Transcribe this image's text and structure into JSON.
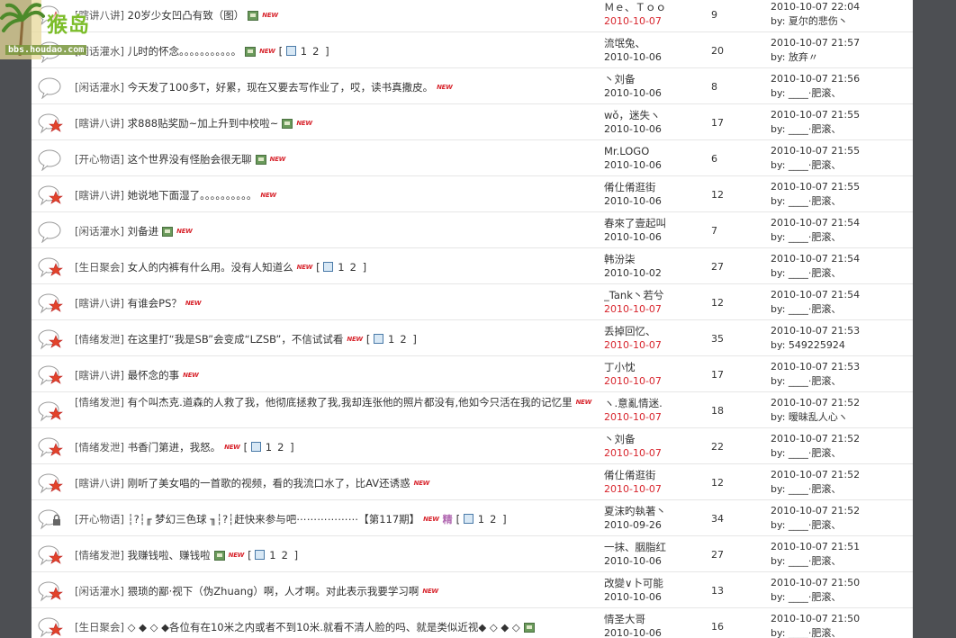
{
  "logo": {
    "text": "猴岛",
    "url": "bbs.houdao.com"
  },
  "threads": [
    {
      "icon": "hot",
      "forum": "[瞎讲八讲]",
      "subject": "20岁少女凹凸有致（图）",
      "image": true,
      "new": true,
      "digest": false,
      "pages": [],
      "author": "Ｍｅ、Ｔｏｏ",
      "date": "2010-10-07",
      "today": true,
      "replies": "9",
      "last_time": "2010-10-07 22:04",
      "last_by": "by: 夏尔的悲伤丶"
    },
    {
      "icon": "normal",
      "forum": "[闲话灌水]",
      "subject": "儿时的怀念。。。。。。。。。。。",
      "image": true,
      "new": true,
      "digest": false,
      "pages": [
        "1",
        "2"
      ],
      "author": "流氓兔、",
      "date": "2010-10-06",
      "today": false,
      "replies": "20",
      "last_time": "2010-10-07 21:57",
      "last_by": "by:          放弃〃"
    },
    {
      "icon": "normal",
      "forum": "[闲话灌水]",
      "subject": "今天发了100多T，好累，现在又要去写作业了，哎，读书真撒皮。",
      "image": false,
      "new": true,
      "digest": false,
      "pages": [],
      "author": "丶刘备",
      "date": "2010-10-06",
      "today": false,
      "replies": "8",
      "last_time": "2010-10-07 21:56",
      "last_by": "by: ____·肥滚、"
    },
    {
      "icon": "hot",
      "forum": "[瞎讲八讲]",
      "subject": "求888贴奖励~加上升到中校啦~",
      "image": true,
      "new": true,
      "digest": false,
      "pages": [],
      "author": "wǒ，迷失ヽ",
      "date": "2010-10-06",
      "today": false,
      "replies": "17",
      "last_time": "2010-10-07 21:55",
      "last_by": "by: ____·肥滚、"
    },
    {
      "icon": "normal",
      "forum": "[开心物语]",
      "subject": "这个世界没有怪胎会很无聊",
      "image": true,
      "new": true,
      "digest": false,
      "pages": [],
      "author": "Mr.LOGO",
      "date": "2010-10-06",
      "today": false,
      "replies": "6",
      "last_time": "2010-10-07 21:55",
      "last_by": "by: ____·肥滚、"
    },
    {
      "icon": "hot",
      "forum": "[瞎讲八讲]",
      "subject": "她说地下面湿了。。。。。。。。。。",
      "image": false,
      "new": true,
      "digest": false,
      "pages": [],
      "author": "倄仩倄逛街",
      "date": "2010-10-06",
      "today": false,
      "replies": "12",
      "last_time": "2010-10-07 21:55",
      "last_by": "by: ____·肥滚、"
    },
    {
      "icon": "normal",
      "forum": "[闲话灌水]",
      "subject": "刘备进",
      "image": true,
      "new": true,
      "digest": false,
      "pages": [],
      "author": "春來了壹起叫",
      "date": "2010-10-06",
      "today": false,
      "replies": "7",
      "last_time": "2010-10-07 21:54",
      "last_by": "by: ____·肥滚、"
    },
    {
      "icon": "hot",
      "forum": "[生日聚会]",
      "subject": "女人的内裤有什么用。没有人知道么",
      "image": false,
      "new": true,
      "digest": false,
      "pages": [
        "1",
        "2"
      ],
      "author": "韩汾柒",
      "date": "2010-10-02",
      "today": false,
      "replies": "27",
      "last_time": "2010-10-07 21:54",
      "last_by": "by: ____·肥滚、"
    },
    {
      "icon": "hot",
      "forum": "[瞎讲八讲]",
      "subject": "有谁会PS？",
      "image": false,
      "new": true,
      "digest": false,
      "pages": [],
      "author": "_Tank丶若兮",
      "date": "2010-10-07",
      "today": true,
      "replies": "12",
      "last_time": "2010-10-07 21:54",
      "last_by": "by: ____·肥滚、"
    },
    {
      "icon": "hot",
      "forum": "[情绪发泄]",
      "subject": "在这里打“我是SB”会变成“LZSB”，不信试试看",
      "image": false,
      "new": true,
      "digest": false,
      "pages": [
        "1",
        "2"
      ],
      "author": "丢掉回忆、",
      "date": "2010-10-07",
      "today": true,
      "replies": "35",
      "last_time": "2010-10-07 21:53",
      "last_by": "by: 549225924"
    },
    {
      "icon": "hot",
      "forum": "[瞎讲八讲]",
      "subject": "最怀念的事",
      "image": false,
      "new": true,
      "digest": false,
      "pages": [],
      "author": "丁小忱",
      "date": "2010-10-07",
      "today": true,
      "replies": "17",
      "last_time": "2010-10-07 21:53",
      "last_by": "by: ____·肥滚、"
    },
    {
      "icon": "hot",
      "forum": "[情绪发泄]",
      "subject": "有个叫杰克.道森的人救了我，他彻底拯救了我,我却连张他的照片都没有,他如今只活在我的记忆里",
      "image": false,
      "new": true,
      "digest": false,
      "pages": [],
      "author": "ヽ.意亂情迷.",
      "date": "2010-10-07",
      "today": true,
      "replies": "18",
      "last_time": "2010-10-07 21:52",
      "last_by": "by: 暧昧乱人心ヽ",
      "wrap": true
    },
    {
      "icon": "hot",
      "forum": "[情绪发泄]",
      "subject": "书香门第进，我怒。",
      "image": false,
      "new": true,
      "digest": false,
      "pages": [
        "1",
        "2"
      ],
      "author": "丶刘备",
      "date": "2010-10-07",
      "today": true,
      "replies": "22",
      "last_time": "2010-10-07 21:52",
      "last_by": "by: ____·肥滚、"
    },
    {
      "icon": "hot",
      "forum": "[瞎讲八讲]",
      "subject": "刚听了美女唱的一首歌的视频，看的我流口水了，比AV还诱惑",
      "image": false,
      "new": true,
      "digest": false,
      "pages": [],
      "author": "倄仩倄逛街",
      "date": "2010-10-07",
      "today": true,
      "replies": "12",
      "last_time": "2010-10-07 21:52",
      "last_by": "by: ____·肥滚、"
    },
    {
      "icon": "locked",
      "forum": "[开心物语]",
      "subject": "┆?┆╓ 梦幻三色球 ╖┆?┆赶快来参与吧⋯⋯⋯⋯⋯⋯【第117期】",
      "image": false,
      "new": true,
      "digest": true,
      "pages": [
        "1",
        "2"
      ],
      "author": "夏沫旳執著丶",
      "date": "2010-09-26",
      "today": false,
      "replies": "34",
      "last_time": "2010-10-07 21:52",
      "last_by": "by: ____·肥滚、"
    },
    {
      "icon": "hot",
      "forum": "[情绪发泄]",
      "subject": "我赚钱啦、赚钱啦",
      "image": true,
      "new": true,
      "digest": false,
      "pages": [
        "1",
        "2"
      ],
      "author": "一抹、胭脂红",
      "date": "2010-10-06",
      "today": false,
      "replies": "27",
      "last_time": "2010-10-07 21:51",
      "last_by": "by: ____·肥滚、"
    },
    {
      "icon": "hot",
      "forum": "[闲话灌水]",
      "subject": "猥琐的鄙·视下（伪Zhuang）啊，人才啊。对此表示我要学习啊",
      "image": false,
      "new": true,
      "digest": false,
      "pages": [],
      "author": "改變∨卜可能",
      "date": "2010-10-06",
      "today": false,
      "replies": "13",
      "last_time": "2010-10-07 21:50",
      "last_by": "by: ____·肥滚、"
    },
    {
      "icon": "hot",
      "forum": "[生日聚会]",
      "subject": "◇ ◆ ◇ ◆各位有在10米之内或者不到10米.就看不清人脸的吗、就是类似近视◆ ◇ ◆ ◇",
      "image": true,
      "new": false,
      "digest": false,
      "pages": [],
      "author": "情圣大哥",
      "date": "2010-10-06",
      "today": false,
      "replies": "16",
      "last_time": "2010-10-07 21:50",
      "last_by": "by: ____·肥滚、"
    }
  ],
  "labels": {
    "new": "NEW",
    "digest": "精",
    "page_open": "[",
    "page_close": "]"
  },
  "colors": {
    "today": "#d8262e",
    "background": "#4d4f53",
    "forum": "#555555"
  }
}
